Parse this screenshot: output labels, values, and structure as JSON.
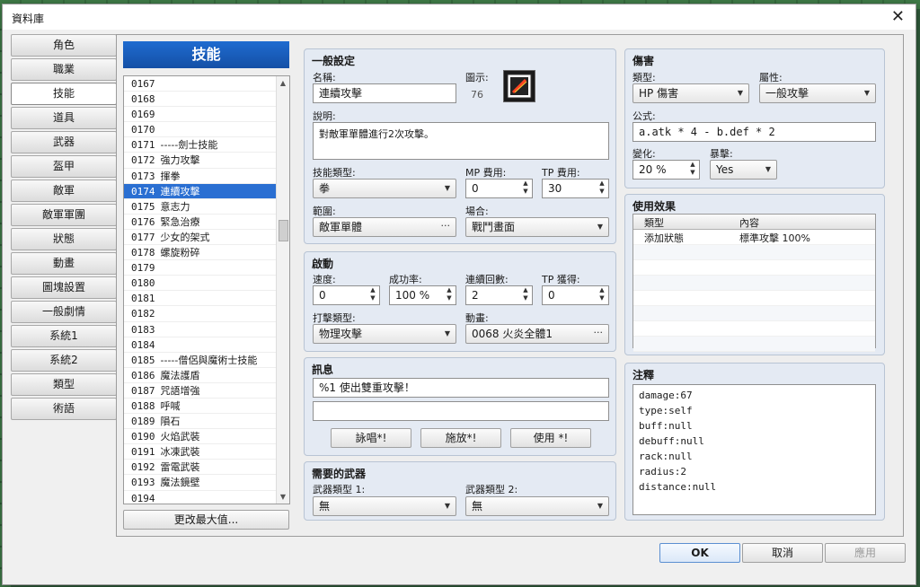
{
  "window": {
    "title": "資料庫"
  },
  "categories": [
    "角色",
    "職業",
    "技能",
    "道具",
    "武器",
    "盔甲",
    "敵軍",
    "敵軍軍團",
    "狀態",
    "動畫",
    "圖塊設置",
    "一般劇情",
    "系統1",
    "系統2",
    "類型",
    "術語"
  ],
  "active_category": "技能",
  "skill_list": {
    "header": "技能",
    "rows": [
      {
        "id": "0167",
        "name": ""
      },
      {
        "id": "0168",
        "name": ""
      },
      {
        "id": "0169",
        "name": ""
      },
      {
        "id": "0170",
        "name": ""
      },
      {
        "id": "0171",
        "name": "-----劍士技能"
      },
      {
        "id": "0172",
        "name": "強力攻擊"
      },
      {
        "id": "0173",
        "name": "揮拳"
      },
      {
        "id": "0174",
        "name": "連續攻擊"
      },
      {
        "id": "0175",
        "name": "意志力"
      },
      {
        "id": "0176",
        "name": "緊急治療"
      },
      {
        "id": "0177",
        "name": "少女的架式"
      },
      {
        "id": "0178",
        "name": "螺旋粉碎"
      },
      {
        "id": "0179",
        "name": ""
      },
      {
        "id": "0180",
        "name": ""
      },
      {
        "id": "0181",
        "name": ""
      },
      {
        "id": "0182",
        "name": ""
      },
      {
        "id": "0183",
        "name": ""
      },
      {
        "id": "0184",
        "name": ""
      },
      {
        "id": "0185",
        "name": "-----僧侶與魔術士技能"
      },
      {
        "id": "0186",
        "name": "魔法護盾"
      },
      {
        "id": "0187",
        "name": "咒語增強"
      },
      {
        "id": "0188",
        "name": "呼喊"
      },
      {
        "id": "0189",
        "name": "隕石"
      },
      {
        "id": "0190",
        "name": "火焰武裝"
      },
      {
        "id": "0191",
        "name": "冰凍武裝"
      },
      {
        "id": "0192",
        "name": "雷電武裝"
      },
      {
        "id": "0193",
        "name": "魔法鏡壁"
      },
      {
        "id": "0194",
        "name": ""
      }
    ],
    "selected_id": "0174",
    "change_max_button": "更改最大值..."
  },
  "general": {
    "title": "一般設定",
    "name_label": "名稱:",
    "name_value": "連續攻擊",
    "icon_label": "圖示:",
    "icon_index": "76",
    "desc_label": "說明:",
    "desc_value": "對敵軍單體進行2次攻擊。",
    "skill_type_label": "技能類型:",
    "skill_type_value": "拳",
    "mp_label": "MP 費用:",
    "mp_value": "0",
    "tp_label": "TP 費用:",
    "tp_value": "30",
    "scope_label": "範圍:",
    "scope_value": "敵軍單體",
    "occasion_label": "場合:",
    "occasion_value": "戰鬥畫面"
  },
  "invocation": {
    "title": "啟動",
    "speed_label": "速度:",
    "speed_value": "0",
    "success_label": "成功率:",
    "success_value": "100 %",
    "repeats_label": "連續回數:",
    "repeats_value": "2",
    "tp_gain_label": "TP 獲得:",
    "tp_gain_value": "0",
    "hit_type_label": "打擊類型:",
    "hit_type_value": "物理攻擊",
    "animation_label": "動畫:",
    "animation_value": "0068 火炎全體1"
  },
  "message": {
    "title": "訊息",
    "line1": "%1 使出雙重攻擊！",
    "line2": "",
    "btn_chant": "詠唱*!",
    "btn_cast": "施放*!",
    "btn_use": "使用 *!"
  },
  "weapons": {
    "title": "需要的武器",
    "type1_label": "武器類型 1:",
    "type1_value": "無",
    "type2_label": "武器類型 2:",
    "type2_value": "無"
  },
  "damage": {
    "title": "傷害",
    "type_label": "類型:",
    "type_value": "HP 傷害",
    "element_label": "屬性:",
    "element_value": "一般攻擊",
    "formula_label": "公式:",
    "formula_value": "a.atk * 4 - b.def * 2",
    "variance_label": "變化:",
    "variance_value": "20 %",
    "critical_label": "暴擊:",
    "critical_value": "Yes"
  },
  "effects": {
    "title": "使用效果",
    "col_type": "類型",
    "col_content": "內容",
    "rows": [
      {
        "type": "添加狀態",
        "content": "標準攻擊 100%"
      }
    ]
  },
  "note": {
    "title": "注釋",
    "lines": [
      "damage:67",
      "type:self",
      "buff:null",
      "debuff:null",
      "rack:null",
      "radius:2",
      "distance:null"
    ]
  },
  "footer": {
    "ok": "OK",
    "cancel": "取消",
    "apply": "應用"
  }
}
